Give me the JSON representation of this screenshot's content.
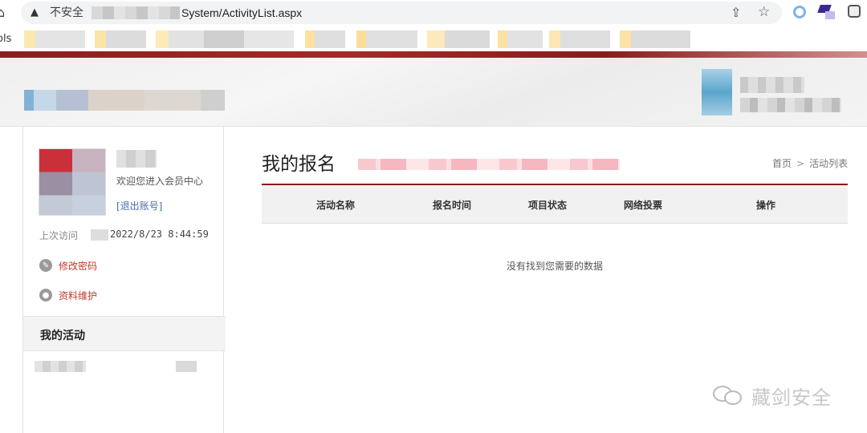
{
  "browser": {
    "insecure_label": "不安全",
    "url_path": "System/ActivityList.aspx",
    "bookmarks_label": "ols"
  },
  "sidebar": {
    "welcome": "欢迎您进入会员中心",
    "logout": "[退出账号]",
    "last_visit_label": "上次访问",
    "last_visit_time": "2022/8/23 8:44:59",
    "links": [
      {
        "label": "修改密码",
        "icon": "pencil-icon"
      },
      {
        "label": "资料维护",
        "icon": "user-icon"
      }
    ],
    "menu_header": "我的活动"
  },
  "main": {
    "title": "我的报名",
    "breadcrumb": {
      "home": "首页",
      "current": "活动列表"
    },
    "table": {
      "columns": [
        "活动名称",
        "报名时间",
        "项目状态",
        "网络投票",
        "操作"
      ],
      "rows": [],
      "empty_message": "没有找到您需要的数据"
    }
  },
  "watermark": {
    "text": "藏剑安全"
  },
  "colors": {
    "brand_red": "#8b1a1a",
    "link_red": "#c0392b",
    "link_blue": "#4a6fa5"
  }
}
